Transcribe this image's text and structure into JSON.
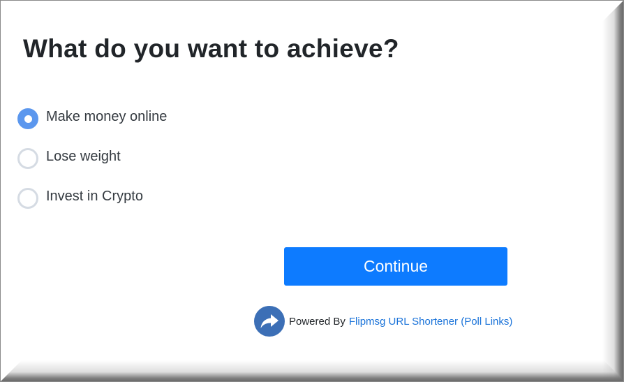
{
  "question": {
    "title": "What do you want to achieve?"
  },
  "options": [
    {
      "label": "Make money online",
      "checked": true
    },
    {
      "label": "Lose weight",
      "checked": false
    },
    {
      "label": "Invest in Crypto",
      "checked": false
    }
  ],
  "actions": {
    "continue_label": "Continue"
  },
  "footer": {
    "powered_by": "Powered By",
    "link_text": "Flipmsg URL Shortener (Poll Links)",
    "icon": "share-arrow-icon"
  },
  "colors": {
    "accent": "#0d7bff",
    "radio_checked": "#5b97ee",
    "radio_unchecked_border": "#d5dbe3",
    "link": "#1a73d9",
    "share_icon_bg": "#3c6fb6"
  }
}
